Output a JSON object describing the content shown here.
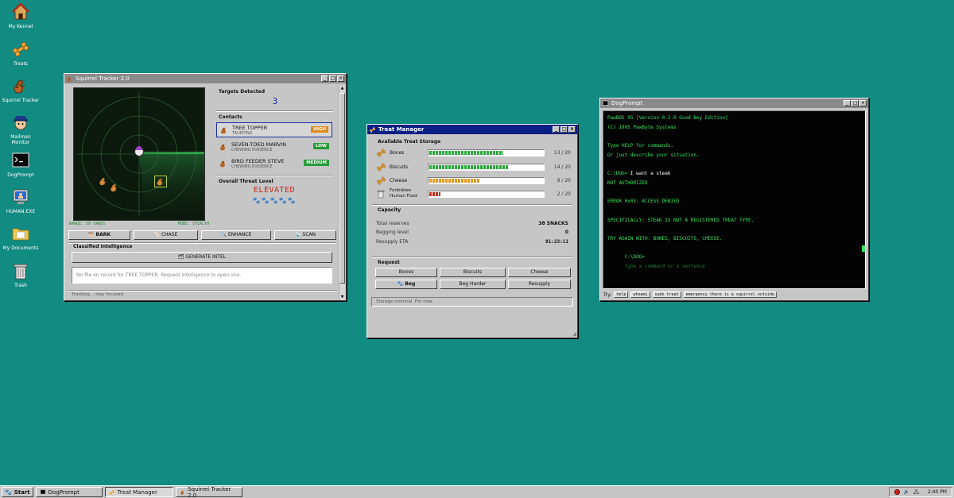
{
  "desktop": {
    "icons": [
      {
        "label": "My Kennel",
        "icon": "house-icon"
      },
      {
        "label": "Treats",
        "icon": "bone-icon"
      },
      {
        "label": "Squirrel Tracker",
        "icon": "squirrel-icon"
      },
      {
        "label": "Mailman Monitor",
        "icon": "mailman-icon"
      },
      {
        "label": "DogPrompt",
        "icon": "terminal-icon"
      },
      {
        "label": "HUMAN.EXE",
        "icon": "computer-icon"
      },
      {
        "label": "My Documents",
        "icon": "folder-icon"
      },
      {
        "label": "Trash",
        "icon": "trash-icon"
      }
    ]
  },
  "squirrel": {
    "title": "Squirrel Tracker 2.0",
    "radar_range": "RANGE: 50 YARDS",
    "radar_mode": "MODE: STEALTH",
    "targets_label": "Targets Detected",
    "targets_count": "3",
    "contacts_label": "Contacts",
    "contacts": [
      {
        "name": "TREE TOPPER",
        "status": "TAUNTING",
        "level": "HIGH",
        "color": "#e08b1d"
      },
      {
        "name": "SEVEN-TOED MARVIN",
        "status": "CHEWING EVIDENCE",
        "level": "LOW",
        "color": "#2a9a3c"
      },
      {
        "name": "BIRD FEEDER STEVE",
        "status": "CHEWING EVIDENCE",
        "level": "MEDIUM",
        "color": "#2a9a3c"
      }
    ],
    "threat_label": "Overall Threat Level",
    "threat_value": "ELEVATED",
    "threat_paws": "🐾🐾🐾🐾🐾",
    "actions": {
      "bark": "BARK",
      "chase": "CHASE",
      "enhance": "ENHANCE",
      "scan": "SCAN"
    },
    "intel_label": "Classified Intelligence",
    "intel_button": "GENERATE INTEL",
    "intel_text": "No file on record for TREE TOPPER. Request intelligence to open one.",
    "status": "Tracking... stay focused."
  },
  "treats": {
    "title": "Treat Manager",
    "storage_label": "Available Treat Storage",
    "items": [
      {
        "name": "Bones",
        "count": "13 / 20",
        "fraction": 0.65,
        "color": "#27a83a"
      },
      {
        "name": "Biscuits",
        "count": "14 / 20",
        "fraction": 0.7,
        "color": "#27a83a"
      },
      {
        "name": "Cheese",
        "count": "9 / 20",
        "fraction": 0.45,
        "color": "#e8961f"
      },
      {
        "name": "Forbidden Human Food",
        "name1": "Forbidden",
        "name2": "Human Food",
        "count": "2 / 20",
        "fraction": 0.1,
        "color": "#d22a1a"
      }
    ],
    "capacity_label": "Capacity",
    "total_label": "Total reserves",
    "total_value": "38 SNACKS",
    "begging_label": "Begging level",
    "begging_value": "0",
    "resupply_label": "Resupply ETA",
    "resupply_value": "01:23:11",
    "request_label": "Request",
    "buttons": {
      "bones": "Bones",
      "biscuits": "Biscuits",
      "cheese": "Cheese",
      "beg": "Beg",
      "beg_harder": "Beg Harder",
      "resupply": "Resupply"
    },
    "status": "Storage nominal. For now."
  },
  "dogprompt": {
    "title": "DogPrompt",
    "lines": [
      "PawDOS 95 [Version 0.2.0 Good Boy Edition]",
      "(C) 1995 PawByte Systems",
      "",
      "Type HELP for commands.",
      "Or just describe your situation.",
      "",
      "",
      "NOT AUTHORIZED",
      "",
      "ERROR 0x03: ACCESS DENIED",
      "",
      "SPECIFICALLY: STEAK IS NOT A REGISTERED TREAT TYPE.",
      "",
      "TRY AGAIN WITH: BONES, BISCUITS, CHEESE."
    ],
    "prompt": "C:\\DOG>",
    "command": "I want a steak",
    "input_placeholder": "type a command or a sentence",
    "try_label": "Try:",
    "chips": [
      "help",
      "whoami",
      "sudo treat",
      "emergency there is a squirrel outside"
    ]
  },
  "taskbar": {
    "start": "Start",
    "tasks": [
      "DogPrompt",
      "Treat Manager",
      "Squirrel Tracker 2.0"
    ],
    "clock": "2:40 PM"
  }
}
